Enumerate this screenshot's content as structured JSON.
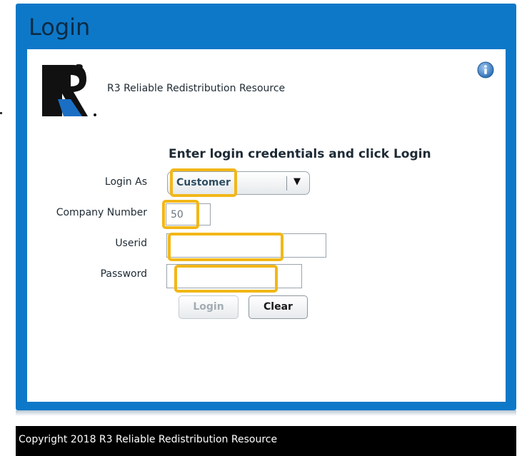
{
  "window": {
    "title": "Login"
  },
  "brand": {
    "app_name": "R3 Reliable Redistribution Resource",
    "logo_text": "R3"
  },
  "form": {
    "heading": "Enter login credentials and click Login",
    "login_as": {
      "label": "Login As",
      "selected": "Customer",
      "arrow": "▼"
    },
    "company_number": {
      "label": "Company Number",
      "value": "50"
    },
    "userid": {
      "label": "Userid",
      "value": ""
    },
    "password": {
      "label": "Password",
      "value": ""
    },
    "buttons": {
      "login": "Login",
      "clear": "Clear"
    }
  },
  "footer": {
    "copyright": "Copyright 2018 R3 Reliable Redistribution Resource"
  },
  "colors": {
    "frame": "#0e78c8",
    "title": "#0b2b44",
    "highlight": "#f2b718",
    "footer": "#000000"
  },
  "icons": {
    "info": "info-icon",
    "logo": "r3-logo"
  }
}
